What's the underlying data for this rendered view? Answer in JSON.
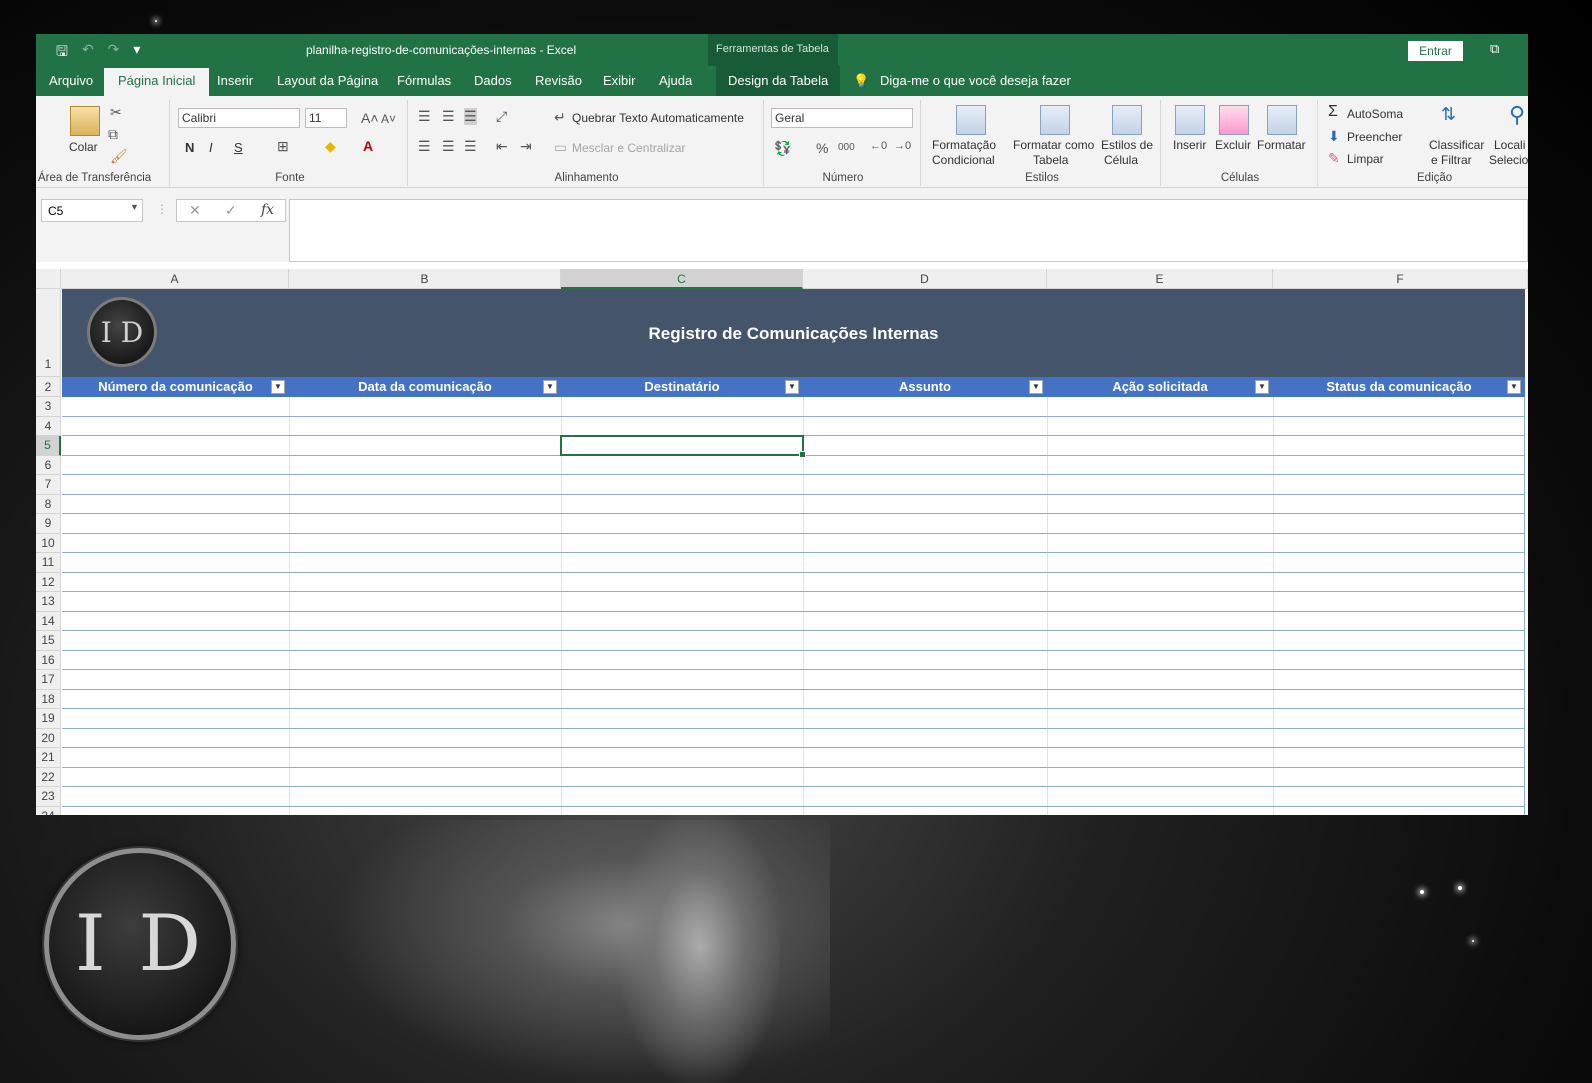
{
  "titlebar": {
    "title": "planilha-registro-de-comunicações-internas  -  Excel",
    "tools_label": "Ferramentas de Tabela",
    "signin": "Entrar"
  },
  "tabs": [
    "Arquivo",
    "Página Inicial",
    "Inserir",
    "Layout da Página",
    "Fórmulas",
    "Dados",
    "Revisão",
    "Exibir",
    "Ajuda",
    "Design da Tabela"
  ],
  "tellme": "Diga-me o que você deseja fazer",
  "ribbon": {
    "clipboard": {
      "paste": "Colar",
      "label": "Área de Transferência"
    },
    "font": {
      "name": "Calibri",
      "size": "11",
      "bold": "N",
      "italic": "I",
      "underline": "S",
      "label": "Fonte"
    },
    "alignment": {
      "wrap": "Quebrar Texto Automaticamente",
      "merge": "Mesclar e Centralizar",
      "label": "Alinhamento"
    },
    "number": {
      "format": "Geral",
      "label": "Número"
    },
    "styles": {
      "conditional_1": "Formatação",
      "conditional_2": "Condicional",
      "as_table_1": "Formatar como",
      "as_table_2": "Tabela",
      "cell_styles_1": "Estilos de",
      "cell_styles_2": "Célula",
      "label": "Estilos"
    },
    "cells": {
      "insert": "Inserir",
      "delete": "Excluir",
      "format": "Formatar",
      "label": "Células"
    },
    "editing": {
      "autosum": "AutoSoma",
      "fill": "Preencher",
      "clear": "Limpar",
      "sort_1": "Classificar",
      "sort_2": "e Filtrar",
      "find_1": "Locali",
      "find_2": "Selecio",
      "label": "Edição"
    }
  },
  "formula_bar": {
    "namebox": "C5",
    "fx": "fx",
    "value": ""
  },
  "columns": [
    "A",
    "B",
    "C",
    "D",
    "E",
    "F"
  ],
  "selected_cell": "C5",
  "sheet": {
    "title": "Registro de Comunicações Internas",
    "logo_text": "I D",
    "headers": [
      "Número da comunicação",
      "Data da comunicação",
      "Destinatário",
      "Assunto",
      "Ação solicitada",
      "Status da comunicação"
    ],
    "row_numbers": [
      "1",
      "2",
      "3",
      "4",
      "5",
      "6",
      "7",
      "8",
      "9",
      "10",
      "11",
      "12",
      "13",
      "14",
      "15",
      "16",
      "17",
      "18",
      "19",
      "20",
      "21",
      "22",
      "23",
      "24"
    ]
  },
  "background_logo_text": "I D"
}
